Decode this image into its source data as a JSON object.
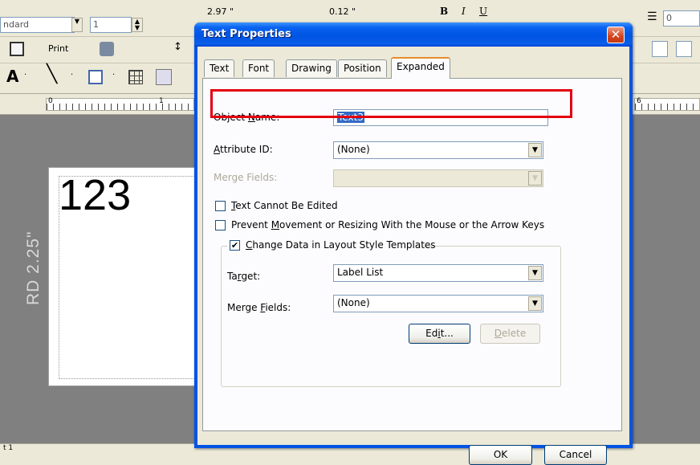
{
  "app": {
    "toolbar": {
      "style_combo": "ndard",
      "size_combo": "1",
      "print_label": "Print",
      "measure_1": "2.97 \"",
      "measure_2": "0.12 \"",
      "bold": "B",
      "italic": "I",
      "underline": "U",
      "spacing_value": "0"
    },
    "ruler": {
      "left_markers": [
        "0",
        "1"
      ],
      "right_marker": "6"
    },
    "canvas": {
      "text_object": "123",
      "label_type": "RD 2.25\""
    },
    "status": "t 1"
  },
  "dialog": {
    "title": "Text Properties",
    "close_glyph": "✕",
    "tabs": [
      {
        "label": "Text",
        "active": false
      },
      {
        "label": "Font",
        "active": false
      },
      {
        "label": "Drawing",
        "active": false
      },
      {
        "label": "Position",
        "active": false
      },
      {
        "label": "Expanded",
        "active": true
      }
    ],
    "object_name": {
      "label_pre": "Object ",
      "label_key": "N",
      "label_post": "ame:",
      "value": "Text3"
    },
    "attribute_id": {
      "label_key": "A",
      "label_post": "ttribute ID:",
      "value": "(None)"
    },
    "merge_fields_top": {
      "label": "Merge Fields:",
      "value": ""
    },
    "checkboxes": {
      "cannot_edit": {
        "label_key": "T",
        "label_post": "ext Cannot Be Edited",
        "checked": false
      },
      "prevent_move": {
        "label_pre": "Prevent ",
        "label_key": "M",
        "label_post": "ovement or Resizing With the Mouse or the Arrow Keys",
        "checked": false
      },
      "change_data": {
        "label_key": "C",
        "label_post": "hange Data in Layout Style Templates",
        "checked": true,
        "mark": "✔"
      }
    },
    "target": {
      "label_pre": "Ta",
      "label_key": "r",
      "label_post": "get:",
      "value": "Label List"
    },
    "merge_fields": {
      "label_pre": "Merge ",
      "label_key": "F",
      "label_post": "ields:",
      "value": "(None)"
    },
    "buttons": {
      "edit": {
        "pre": "Ed",
        "key": "i",
        "post": "t..."
      },
      "delete": {
        "key": "D",
        "post": "elete"
      },
      "ok": "OK",
      "cancel": "Cancel"
    },
    "dropdown_arrow": "▼",
    "highlight_color": "#e3000f"
  }
}
